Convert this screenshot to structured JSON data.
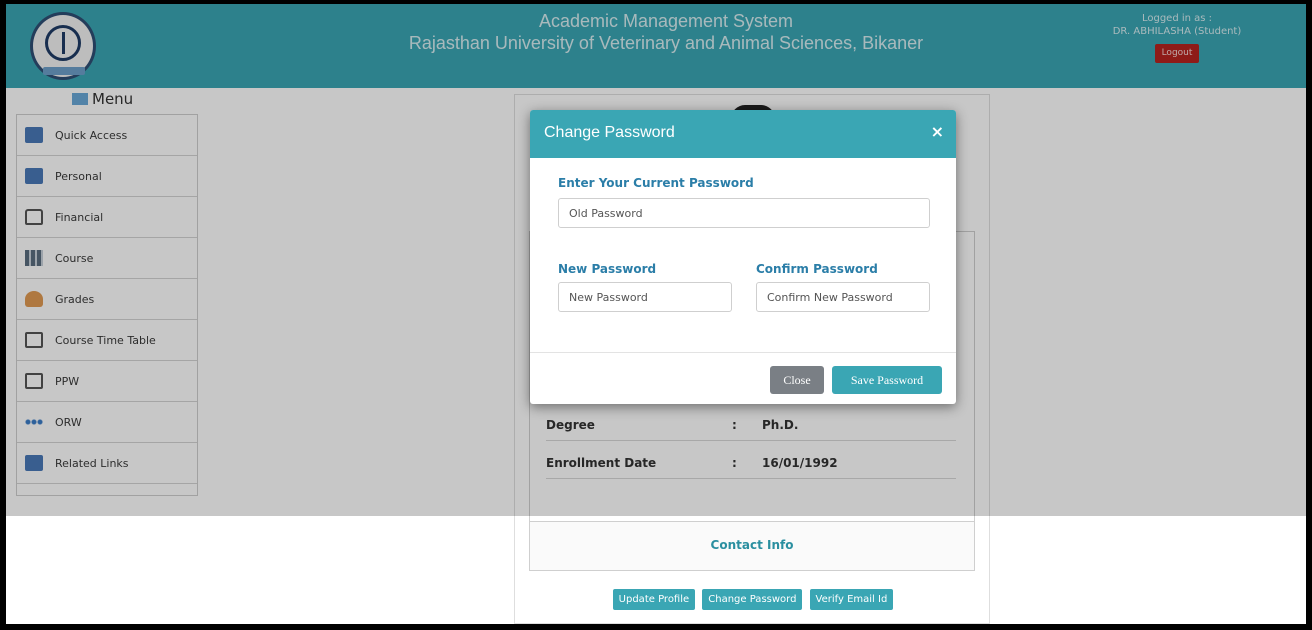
{
  "header": {
    "title_line1": "Academic Management System",
    "title_line2": "Rajasthan University of Veterinary and Animal Sciences, Bikaner",
    "logged_in_label": "Logged in as :",
    "user_name": "DR. ABHILASHA (Student)",
    "logout_label": "Logout"
  },
  "sidebar": {
    "menu_title": "Menu",
    "items": [
      {
        "label": "Quick Access",
        "icon": "quick-access-icon"
      },
      {
        "label": "Personal",
        "icon": "personal-icon"
      },
      {
        "label": "Financial",
        "icon": "lock-icon"
      },
      {
        "label": "Course",
        "icon": "grid-icon"
      },
      {
        "label": "Grades",
        "icon": "person-icon"
      },
      {
        "label": "Course Time Table",
        "icon": "calendar-icon"
      },
      {
        "label": "PPW",
        "icon": "calendar-icon"
      },
      {
        "label": "ORW",
        "icon": "dots-icon"
      },
      {
        "label": "Related Links",
        "icon": "links-icon"
      }
    ]
  },
  "profile": {
    "rows": [
      {
        "label": "Degree",
        "sep": ":",
        "value": "Ph.D."
      },
      {
        "label": "Enrollment Date",
        "sep": ":",
        "value": "16/01/1992"
      }
    ],
    "contact_label": "Contact Info",
    "buttons": {
      "update_profile": "Update Profile",
      "change_password": "Change Password",
      "verify_email": "Verify Email Id"
    }
  },
  "modal": {
    "title": "Change Password",
    "close_x": "×",
    "current_label": "Enter Your Current Password",
    "current_placeholder": "Old Password",
    "new_label": "New Password",
    "new_placeholder": "New Password",
    "confirm_label": "Confirm Password",
    "confirm_placeholder": "Confirm New Password",
    "close_button": "Close",
    "save_button": "Save Password"
  },
  "colors": {
    "accent": "#3aa6b4",
    "logout": "#b7231f",
    "label_blue": "#2b7ea8"
  }
}
